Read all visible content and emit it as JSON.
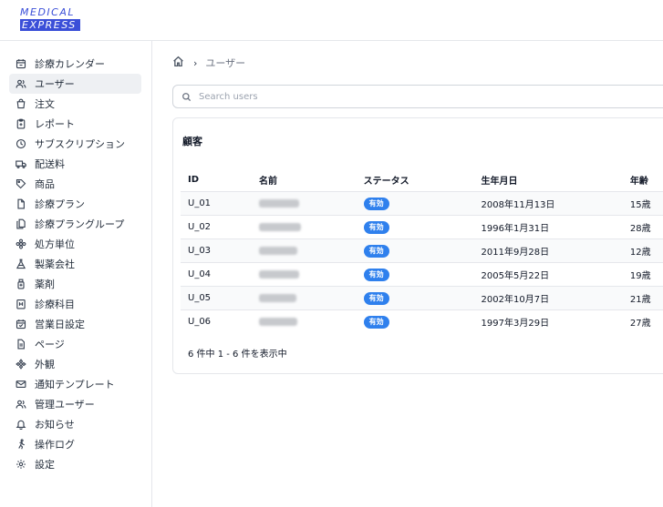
{
  "logo": {
    "line1": "MEDICAL",
    "line2": "EXPRESS"
  },
  "sidebar": {
    "items": [
      {
        "label": "診療カレンダー",
        "icon": "calendar-icon",
        "active": false
      },
      {
        "label": "ユーザー",
        "icon": "users-icon",
        "active": true
      },
      {
        "label": "注文",
        "icon": "shopping-bag-icon",
        "active": false
      },
      {
        "label": "レポート",
        "icon": "clipboard-icon",
        "active": false
      },
      {
        "label": "サブスクリプション",
        "icon": "clock-icon",
        "active": false
      },
      {
        "label": "配送料",
        "icon": "truck-icon",
        "active": false
      },
      {
        "label": "商品",
        "icon": "tag-icon",
        "active": false
      },
      {
        "label": "診療プラン",
        "icon": "document-icon",
        "active": false
      },
      {
        "label": "診療プラングループ",
        "icon": "documents-icon",
        "active": false
      },
      {
        "label": "処方単位",
        "icon": "cog-flower-icon",
        "active": false
      },
      {
        "label": "製薬会社",
        "icon": "flask-icon",
        "active": false
      },
      {
        "label": "薬剤",
        "icon": "bottle-icon",
        "active": false
      },
      {
        "label": "診療科目",
        "icon": "hospital-icon",
        "active": false
      },
      {
        "label": "営業日設定",
        "icon": "calendar-check-icon",
        "active": false
      },
      {
        "label": "ページ",
        "icon": "page-icon",
        "active": false
      },
      {
        "label": "外観",
        "icon": "palette-icon",
        "active": false
      },
      {
        "label": "通知テンプレート",
        "icon": "mail-icon",
        "active": false
      },
      {
        "label": "管理ユーザー",
        "icon": "admin-users-icon",
        "active": false
      },
      {
        "label": "お知らせ",
        "icon": "bell-icon",
        "active": false
      },
      {
        "label": "操作ログ",
        "icon": "runner-icon",
        "active": false
      },
      {
        "label": "設定",
        "icon": "settings-icon",
        "active": false
      }
    ]
  },
  "breadcrumb": {
    "home_icon": "home-icon",
    "separator": "›",
    "current": "ユーザー"
  },
  "search": {
    "placeholder": "Search users",
    "value": ""
  },
  "card": {
    "title": "顧客",
    "columns": [
      "ID",
      "名前",
      "ステータス",
      "生年月日",
      "年齢"
    ],
    "rows": [
      {
        "id": "U_01",
        "status": "有効",
        "birthdate": "2008年11月13日",
        "age": "15歳"
      },
      {
        "id": "U_02",
        "status": "有効",
        "birthdate": "1996年1月31日",
        "age": "28歳"
      },
      {
        "id": "U_03",
        "status": "有効",
        "birthdate": "2011年9月28日",
        "age": "12歳"
      },
      {
        "id": "U_04",
        "status": "有効",
        "birthdate": "2005年5月22日",
        "age": "19歳"
      },
      {
        "id": "U_05",
        "status": "有効",
        "birthdate": "2002年10月7日",
        "age": "21歳"
      },
      {
        "id": "U_06",
        "status": "有効",
        "birthdate": "1997年3月29日",
        "age": "27歳"
      }
    ],
    "pagination": "6 件中 1 - 6 件を表示中"
  },
  "colors": {
    "accent": "#3b4fd8",
    "badge": "#2f80ed",
    "active_bg": "#eef0f3",
    "border": "#e5e7eb"
  }
}
